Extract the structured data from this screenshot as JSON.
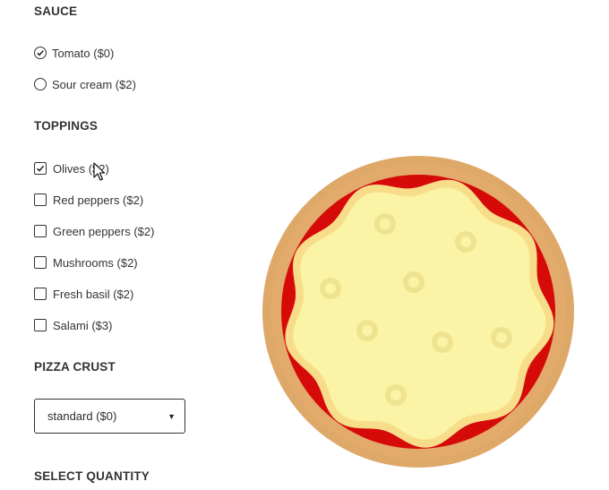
{
  "sauce": {
    "title": "SAUCE",
    "options": [
      {
        "label": "Tomato ($0)",
        "selected": true
      },
      {
        "label": "Sour cream ($2)",
        "selected": false
      }
    ]
  },
  "toppings": {
    "title": "TOPPINGS",
    "options": [
      {
        "label": "Olives ($2)",
        "checked": true
      },
      {
        "label": "Red peppers ($2)",
        "checked": false
      },
      {
        "label": "Green peppers ($2)",
        "checked": false
      },
      {
        "label": "Mushrooms ($2)",
        "checked": false
      },
      {
        "label": "Fresh basil ($2)",
        "checked": false
      },
      {
        "label": "Salami ($3)",
        "checked": false
      }
    ]
  },
  "crust": {
    "title": "PIZZA CRUST",
    "selected_value": "standard ($0)"
  },
  "quantity": {
    "title": "SELECT QUANTITY"
  },
  "pizza": {
    "colors": {
      "crust": "#dea869",
      "sauce": "#d70a0a",
      "cheese_rim": "#f7dd8a",
      "cheese": "#fbf3a5",
      "olive": "#f0e38f"
    }
  }
}
